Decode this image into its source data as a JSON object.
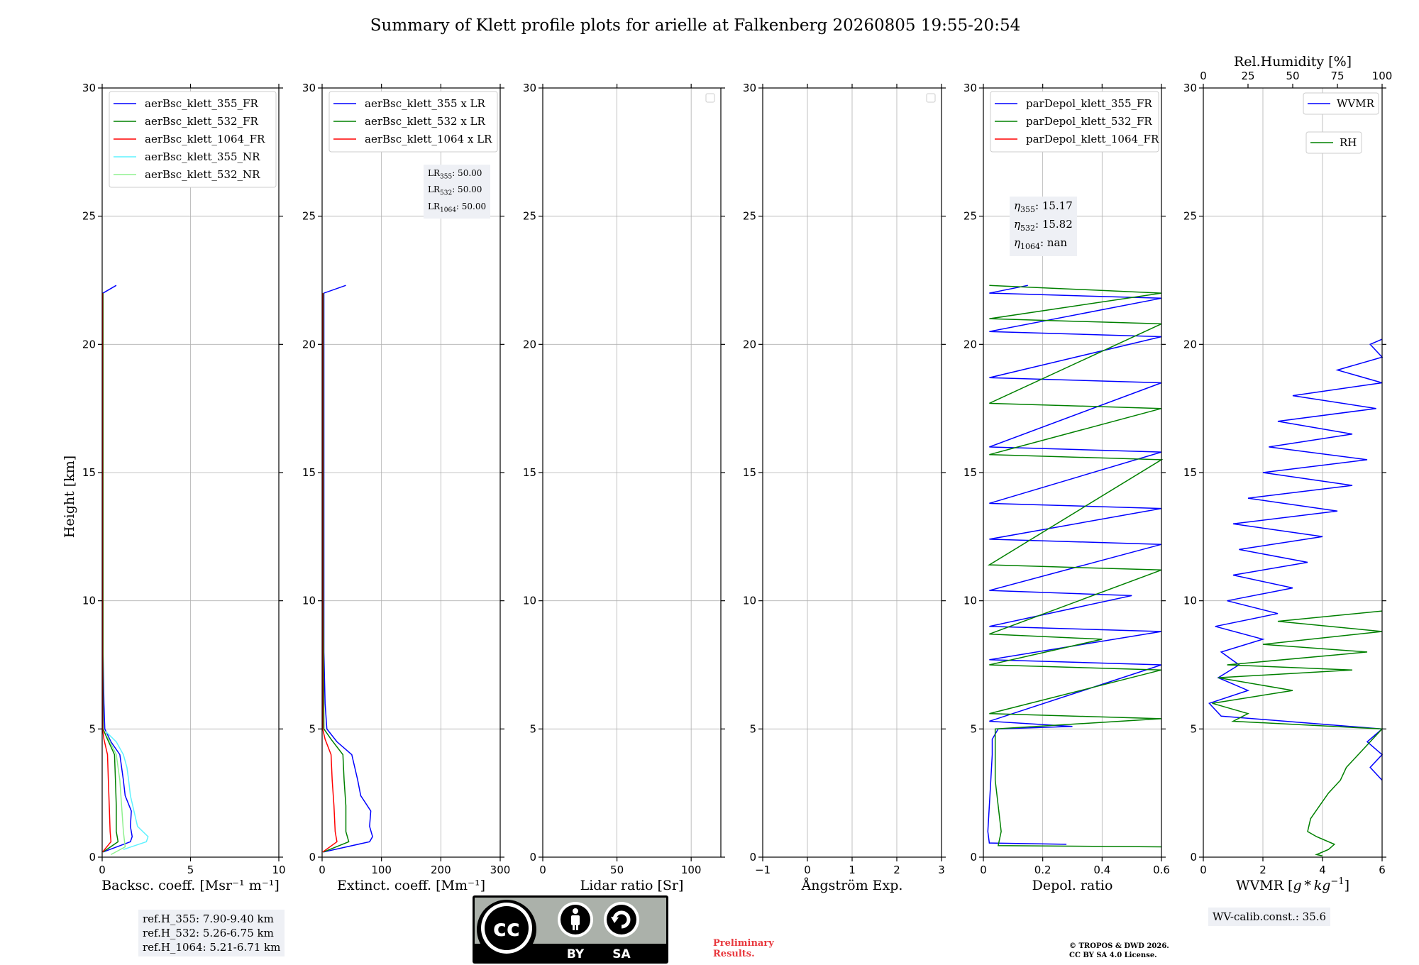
{
  "title": "Summary of Klett profile plots for arielle at Falkenberg 20260805 19:55-20:54",
  "ylabel": "Height [km]",
  "colors": {
    "blue": "#0000ff",
    "green": "#008000",
    "red": "#ff0000",
    "cyan": "#5ef2ff",
    "lightgreen": "#8ff08f"
  },
  "chart_data": [
    {
      "type": "line",
      "name": "backscatter",
      "xlabel": "Backsc. coeff. [Msr⁻¹ m⁻¹]",
      "xlim": [
        0,
        10
      ],
      "xticks": [
        0,
        5,
        10
      ],
      "ylim": [
        0,
        30
      ],
      "yticks": [
        0,
        5,
        10,
        15,
        20,
        25,
        30
      ],
      "legend_position": "upper-right",
      "series": [
        {
          "name": "aerBsc_klett_355_FR",
          "color": "#0000ff"
        },
        {
          "name": "aerBsc_klett_532_FR",
          "color": "#008000"
        },
        {
          "name": "aerBsc_klett_1064_FR",
          "color": "#ff0000"
        },
        {
          "name": "aerBsc_klett_355_NR",
          "color": "#5ef2ff"
        },
        {
          "name": "aerBsc_klett_532_NR",
          "color": "#8ff08f"
        }
      ],
      "profiles": {
        "aerBsc_klett_355_FR": [
          [
            0.05,
            0.2
          ],
          [
            1.6,
            0.6
          ],
          [
            1.7,
            0.8
          ],
          [
            1.6,
            1.2
          ],
          [
            1.65,
            1.8
          ],
          [
            1.3,
            2.4
          ],
          [
            1.2,
            3.0
          ],
          [
            1.1,
            3.5
          ],
          [
            1.0,
            4.0
          ],
          [
            0.5,
            4.5
          ],
          [
            0.15,
            5.0
          ],
          [
            0.1,
            6.0
          ],
          [
            0.05,
            8.0
          ],
          [
            0.05,
            12.0
          ],
          [
            0.05,
            16.0
          ],
          [
            0.05,
            20.0
          ],
          [
            0.05,
            22.0
          ],
          [
            0.8,
            22.3
          ]
        ],
        "aerBsc_klett_532_FR": [
          [
            0.05,
            0.2
          ],
          [
            0.9,
            0.6
          ],
          [
            0.8,
            1.0
          ],
          [
            0.8,
            2.0
          ],
          [
            0.75,
            3.0
          ],
          [
            0.7,
            4.0
          ],
          [
            0.3,
            4.6
          ],
          [
            0.05,
            5.0
          ],
          [
            0.05,
            10.0
          ],
          [
            0.05,
            22.0
          ]
        ],
        "aerBsc_klett_1064_FR": [
          [
            0.02,
            0.2
          ],
          [
            0.5,
            0.6
          ],
          [
            0.45,
            1.0
          ],
          [
            0.4,
            2.0
          ],
          [
            0.35,
            3.0
          ],
          [
            0.3,
            4.0
          ],
          [
            0.1,
            4.6
          ],
          [
            0.02,
            5.0
          ],
          [
            0.02,
            10.0
          ],
          [
            0.02,
            22.0
          ]
        ],
        "aerBsc_klett_355_NR": [
          [
            1.2,
            0.3
          ],
          [
            2.5,
            0.6
          ],
          [
            2.6,
            0.8
          ],
          [
            2.0,
            1.2
          ],
          [
            1.8,
            1.8
          ],
          [
            1.6,
            2.4
          ],
          [
            1.5,
            3.0
          ],
          [
            1.4,
            3.5
          ],
          [
            1.2,
            4.0
          ],
          [
            0.8,
            4.5
          ],
          [
            0.2,
            4.9
          ]
        ],
        "aerBsc_klett_532_NR": [
          [
            0.5,
            0.1
          ],
          [
            1.3,
            0.4
          ],
          [
            1.2,
            1.0
          ],
          [
            1.1,
            2.0
          ],
          [
            1.0,
            3.0
          ],
          [
            0.8,
            4.0
          ],
          [
            0.3,
            4.7
          ]
        ]
      }
    },
    {
      "type": "line",
      "name": "extinction",
      "xlabel": "Extinct. coeff. [Mm⁻¹]",
      "xlim": [
        0,
        300
      ],
      "xticks": [
        0,
        100,
        200,
        300
      ],
      "ylim": [
        0,
        30
      ],
      "yticks": [
        0,
        5,
        10,
        15,
        20,
        25,
        30
      ],
      "legend_position": "upper-right",
      "series": [
        {
          "name": "aerBsc_klett_355 x LR",
          "color": "#0000ff"
        },
        {
          "name": "aerBsc_klett_532 x LR",
          "color": "#008000"
        },
        {
          "name": "aerBsc_klett_1064 x LR",
          "color": "#ff0000"
        }
      ],
      "profiles": {
        "aerBsc_klett_355 x LR": [
          [
            2,
            0.2
          ],
          [
            80,
            0.6
          ],
          [
            85,
            0.8
          ],
          [
            80,
            1.2
          ],
          [
            82,
            1.8
          ],
          [
            65,
            2.4
          ],
          [
            60,
            3.0
          ],
          [
            55,
            3.5
          ],
          [
            50,
            4.0
          ],
          [
            25,
            4.5
          ],
          [
            8,
            5.0
          ],
          [
            5,
            6.0
          ],
          [
            3,
            8.0
          ],
          [
            3,
            12.0
          ],
          [
            3,
            16.0
          ],
          [
            3,
            20.0
          ],
          [
            3,
            22.0
          ],
          [
            40,
            22.3
          ]
        ],
        "aerBsc_klett_532 x LR": [
          [
            2,
            0.2
          ],
          [
            45,
            0.6
          ],
          [
            40,
            1.0
          ],
          [
            40,
            2.0
          ],
          [
            37,
            3.0
          ],
          [
            35,
            4.0
          ],
          [
            15,
            4.6
          ],
          [
            3,
            5.0
          ],
          [
            2,
            10.0
          ],
          [
            2,
            22.0
          ]
        ],
        "aerBsc_klett_1064 x LR": [
          [
            1,
            0.2
          ],
          [
            25,
            0.6
          ],
          [
            22,
            1.0
          ],
          [
            20,
            2.0
          ],
          [
            17,
            3.0
          ],
          [
            15,
            4.0
          ],
          [
            5,
            4.6
          ],
          [
            1,
            5.0
          ],
          [
            1,
            10.0
          ],
          [
            1,
            22.0
          ]
        ]
      }
    },
    {
      "type": "line",
      "name": "lidar_ratio",
      "xlabel": "Lidar ratio [Sr]",
      "xlim": [
        0,
        120
      ],
      "xticks": [
        0,
        50,
        100
      ],
      "ylim": [
        0,
        30
      ],
      "yticks": [
        0,
        5,
        10,
        15,
        20,
        25,
        30
      ],
      "series": []
    },
    {
      "type": "line",
      "name": "angstrom",
      "xlabel": "Ångström Exp.",
      "xlim": [
        -1,
        3
      ],
      "xticks": [
        -1,
        0,
        1,
        2,
        3
      ],
      "ylim": [
        0,
        30
      ],
      "yticks": [
        0,
        5,
        10,
        15,
        20,
        25,
        30
      ],
      "series": []
    },
    {
      "type": "line",
      "name": "depolarization",
      "xlabel": "Depol. ratio",
      "xlim": [
        0,
        0.6
      ],
      "xticks": [
        0.0,
        0.2,
        0.4,
        0.6
      ],
      "ylim": [
        0,
        30
      ],
      "yticks": [
        0,
        5,
        10,
        15,
        20,
        25,
        30
      ],
      "legend_position": "upper-right",
      "series": [
        {
          "name": "parDepol_klett_355_FR",
          "color": "#0000ff"
        },
        {
          "name": "parDepol_klett_532_FR",
          "color": "#008000"
        },
        {
          "name": "parDepol_klett_1064_FR",
          "color": "#ff0000"
        }
      ],
      "profiles": {
        "parDepol_klett_355_FR": [
          [
            0.28,
            0.5
          ],
          [
            0.02,
            0.55
          ],
          [
            0.015,
            1.0
          ],
          [
            0.02,
            2.0
          ],
          [
            0.025,
            3.0
          ],
          [
            0.03,
            4.0
          ],
          [
            0.03,
            4.6
          ],
          [
            0.05,
            5.0
          ],
          [
            0.3,
            5.1
          ],
          [
            0.02,
            5.3
          ],
          [
            0.6,
            7.5
          ],
          [
            0.02,
            7.7
          ],
          [
            0.6,
            8.8
          ],
          [
            0.02,
            9.0
          ],
          [
            0.5,
            10.2
          ],
          [
            0.02,
            10.4
          ],
          [
            0.6,
            12.2
          ],
          [
            0.02,
            12.4
          ],
          [
            0.6,
            13.6
          ],
          [
            0.02,
            13.8
          ],
          [
            0.6,
            15.8
          ],
          [
            0.02,
            16.0
          ],
          [
            0.6,
            18.5
          ],
          [
            0.02,
            18.7
          ],
          [
            0.6,
            20.3
          ],
          [
            0.02,
            20.5
          ],
          [
            0.6,
            21.8
          ],
          [
            0.02,
            22.0
          ],
          [
            0.15,
            22.3
          ]
        ],
        "parDepol_klett_532_FR": [
          [
            0.6,
            0.4
          ],
          [
            0.05,
            0.45
          ],
          [
            0.06,
            1.0
          ],
          [
            0.05,
            2.0
          ],
          [
            0.04,
            3.0
          ],
          [
            0.04,
            4.0
          ],
          [
            0.04,
            5.0
          ],
          [
            0.6,
            5.4
          ],
          [
            0.02,
            5.6
          ],
          [
            0.6,
            7.3
          ],
          [
            0.02,
            7.5
          ],
          [
            0.4,
            8.5
          ],
          [
            0.02,
            8.7
          ],
          [
            0.6,
            11.2
          ],
          [
            0.02,
            11.4
          ],
          [
            0.6,
            15.5
          ],
          [
            0.02,
            15.7
          ],
          [
            0.6,
            17.5
          ],
          [
            0.02,
            17.7
          ],
          [
            0.6,
            20.8
          ],
          [
            0.02,
            21.0
          ],
          [
            0.6,
            22.0
          ],
          [
            0.02,
            22.3
          ]
        ]
      }
    },
    {
      "type": "line",
      "name": "water_vapor",
      "xlabel": "WVMR [$g*kg^{-1}$]",
      "xlim": [
        0,
        6
      ],
      "xticks": [
        0,
        2,
        4,
        6
      ],
      "top_xlabel": "Rel.Humidity [%]",
      "top_xlim": [
        0,
        100
      ],
      "top_xticks": [
        0,
        25,
        50,
        75,
        100
      ],
      "ylim": [
        0,
        30
      ],
      "yticks": [
        0,
        5,
        10,
        15,
        20,
        25,
        30
      ],
      "series": [
        {
          "name": "WVMR",
          "color": "#0000ff",
          "axis": "bottom"
        },
        {
          "name": "RH",
          "color": "#008000",
          "axis": "bottom"
        }
      ],
      "profiles": {
        "WVMR": [
          [
            6.0,
            3.0
          ],
          [
            5.6,
            3.5
          ],
          [
            6.0,
            4.0
          ],
          [
            5.5,
            4.5
          ],
          [
            6.0,
            5.0
          ],
          [
            0.6,
            5.5
          ],
          [
            0.2,
            6.0
          ],
          [
            1.5,
            6.5
          ],
          [
            0.5,
            7.0
          ],
          [
            1.2,
            7.5
          ],
          [
            0.6,
            8.0
          ],
          [
            2.0,
            8.5
          ],
          [
            0.4,
            9.0
          ],
          [
            2.5,
            9.5
          ],
          [
            0.8,
            10.0
          ],
          [
            3.0,
            10.5
          ],
          [
            1.0,
            11.0
          ],
          [
            3.5,
            11.5
          ],
          [
            1.2,
            12.0
          ],
          [
            4.0,
            12.5
          ],
          [
            1.0,
            13.0
          ],
          [
            4.5,
            13.5
          ],
          [
            1.5,
            14.0
          ],
          [
            5.0,
            14.5
          ],
          [
            2.0,
            15.0
          ],
          [
            5.5,
            15.5
          ],
          [
            2.2,
            16.0
          ],
          [
            5.0,
            16.5
          ],
          [
            2.5,
            17.0
          ],
          [
            5.8,
            17.5
          ],
          [
            3.0,
            18.0
          ],
          [
            6.0,
            18.5
          ],
          [
            4.5,
            19.0
          ],
          [
            6.0,
            19.5
          ],
          [
            5.6,
            20.0
          ],
          [
            6.0,
            20.2
          ]
        ],
        "RH": [
          [
            4.0,
            0.05
          ],
          [
            3.8,
            0.1
          ],
          [
            4.2,
            0.3
          ],
          [
            4.4,
            0.5
          ],
          [
            3.8,
            0.8
          ],
          [
            3.5,
            1.0
          ],
          [
            3.6,
            1.5
          ],
          [
            3.9,
            2.0
          ],
          [
            4.2,
            2.5
          ],
          [
            4.6,
            3.0
          ],
          [
            4.8,
            3.5
          ],
          [
            5.2,
            4.0
          ],
          [
            5.6,
            4.5
          ],
          [
            6.0,
            5.0
          ],
          [
            1.0,
            5.3
          ],
          [
            1.5,
            5.6
          ],
          [
            0.3,
            6.0
          ],
          [
            3.0,
            6.5
          ],
          [
            0.5,
            7.0
          ],
          [
            5.0,
            7.3
          ],
          [
            0.8,
            7.5
          ],
          [
            5.5,
            8.0
          ],
          [
            2.0,
            8.3
          ],
          [
            6.0,
            8.8
          ],
          [
            2.5,
            9.2
          ],
          [
            6.0,
            9.6
          ]
        ]
      }
    }
  ],
  "legend_wv": {
    "wvmr": "WVMR",
    "rh": "RH"
  },
  "boxes": {
    "lr": {
      "l355": ": 50.00",
      "l532": ": 50.00",
      "l1064": ": 50.00"
    },
    "eta": {
      "e355": ": 15.17",
      "e532": ": 15.82",
      "e1064": ": nan"
    },
    "refh": {
      "r355": "ref.H_355: 7.90-9.40 km",
      "r532": "ref.H_532: 5.26-6.75 km",
      "r1064": "ref.H_1064: 5.21-6.71 km"
    },
    "wvcal": "WV-calib.const.: 35.6"
  },
  "footer": {
    "license_by": "BY",
    "license_sa": "SA",
    "preliminary": [
      "Preliminary",
      "Results."
    ],
    "copyright": [
      "© TROPOS & DWD 2026.",
      "CC BY SA 4.0 License."
    ]
  }
}
